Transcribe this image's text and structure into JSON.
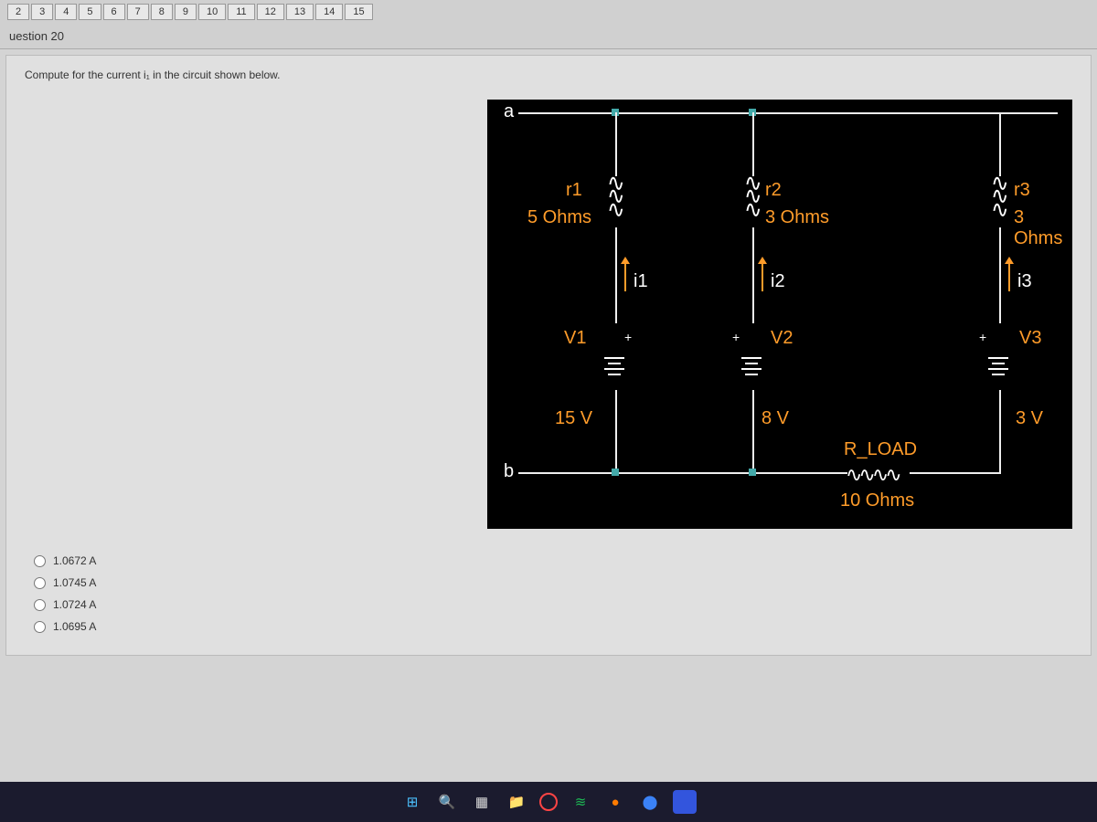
{
  "nav": {
    "tabs": [
      "2",
      "3",
      "4",
      "5",
      "6",
      "7",
      "8",
      "9",
      "10",
      "11",
      "12",
      "13",
      "14",
      "15"
    ]
  },
  "question": {
    "header": "uestion 20",
    "prompt": "Compute for the current i₁ in the circuit shown below."
  },
  "circuit": {
    "node_a": "a",
    "node_b": "b",
    "r1_name": "r1",
    "r1_val": "5 Ohms",
    "r2_name": "r2",
    "r2_val": "3 Ohms",
    "r3_name": "r3",
    "r3_val": "3 Ohms",
    "i1": "i1",
    "i2": "i2",
    "i3": "i3",
    "v1_name": "V1",
    "v1_val": "15 V",
    "v2_name": "V2",
    "v2_val": "8 V",
    "v3_name": "V3",
    "v3_val": "3 V",
    "rload_name": "R_LOAD",
    "rload_val": "10 Ohms",
    "plus": "+"
  },
  "choices": {
    "a": "1.0672 A",
    "b": "1.0745 A",
    "c": "1.0724 A",
    "d": "1.0695 A"
  },
  "taskbar": {
    "start": "⊞",
    "search": "🔍",
    "widgets": "▦",
    "files": "📁",
    "chrome": "◯",
    "spotify": "≋",
    "app1": "●",
    "app2": "⬤",
    "app3": "💬"
  }
}
